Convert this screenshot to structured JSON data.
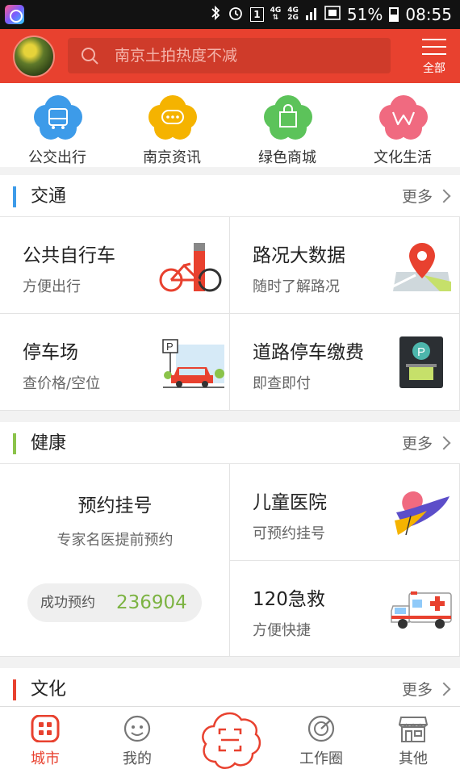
{
  "status_bar": {
    "icons": [
      "app-icon",
      "bluetooth-icon",
      "alarm-icon",
      "sim1-icon",
      "4g-icon",
      "signal-icon",
      "nfc-icon",
      "battery-icon"
    ],
    "sim": "1",
    "net_top": "4G",
    "net_mid": "4G",
    "net_bot": "2G",
    "battery": "51%",
    "time": "08:55"
  },
  "header": {
    "search_placeholder": "南京土拍热度不减",
    "menu_label": "全部",
    "accent": "#e8412f"
  },
  "quick_apps": [
    {
      "label": "公交出行",
      "icon": "bus-icon",
      "color": "#3d9be9"
    },
    {
      "label": "南京资讯",
      "icon": "chat-bubble-icon",
      "color": "#f5b300"
    },
    {
      "label": "绿色商城",
      "icon": "shopping-bag-icon",
      "color": "#5cc35a"
    },
    {
      "label": "文化生活",
      "icon": "culture-w-icon",
      "color": "#f06a80"
    }
  ],
  "sections": {
    "traffic": {
      "title": "交通",
      "more": "更多",
      "color": "#3d9be9",
      "cards": [
        {
          "title": "公共自行车",
          "subtitle": "方便出行",
          "icon": "bicycle-icon"
        },
        {
          "title": "路况大数据",
          "subtitle": "随时了解路况",
          "icon": "map-pin-icon"
        },
        {
          "title": "停车场",
          "subtitle": "查价格/空位",
          "icon": "parking-car-icon"
        },
        {
          "title": "道路停车缴费",
          "subtitle": "即查即付",
          "icon": "parking-meter-icon"
        }
      ]
    },
    "health": {
      "title": "健康",
      "more": "更多",
      "color": "#8bc34a",
      "appointment": {
        "title": "预约挂号",
        "subtitle": "专家名医提前预约",
        "count_label": "成功预约",
        "count_value": "236904"
      },
      "cards": [
        {
          "title": "儿童医院",
          "subtitle": "可预约挂号",
          "icon": "children-hospital-icon"
        },
        {
          "title": "120急救",
          "subtitle": "方便快捷",
          "icon": "ambulance-icon"
        }
      ]
    },
    "culture": {
      "title": "文化",
      "more": "更多",
      "color": "#e8412f"
    }
  },
  "tabbar": {
    "tabs": [
      {
        "label": "城市",
        "icon": "city-grid-icon",
        "active": true
      },
      {
        "label": "我的",
        "icon": "profile-face-icon",
        "active": false
      },
      {
        "label": "",
        "icon": "scan-icon",
        "active": false
      },
      {
        "label": "工作圈",
        "icon": "radar-icon",
        "active": false
      },
      {
        "label": "其他",
        "icon": "store-icon",
        "active": false
      }
    ],
    "active_color": "#e8412f"
  }
}
